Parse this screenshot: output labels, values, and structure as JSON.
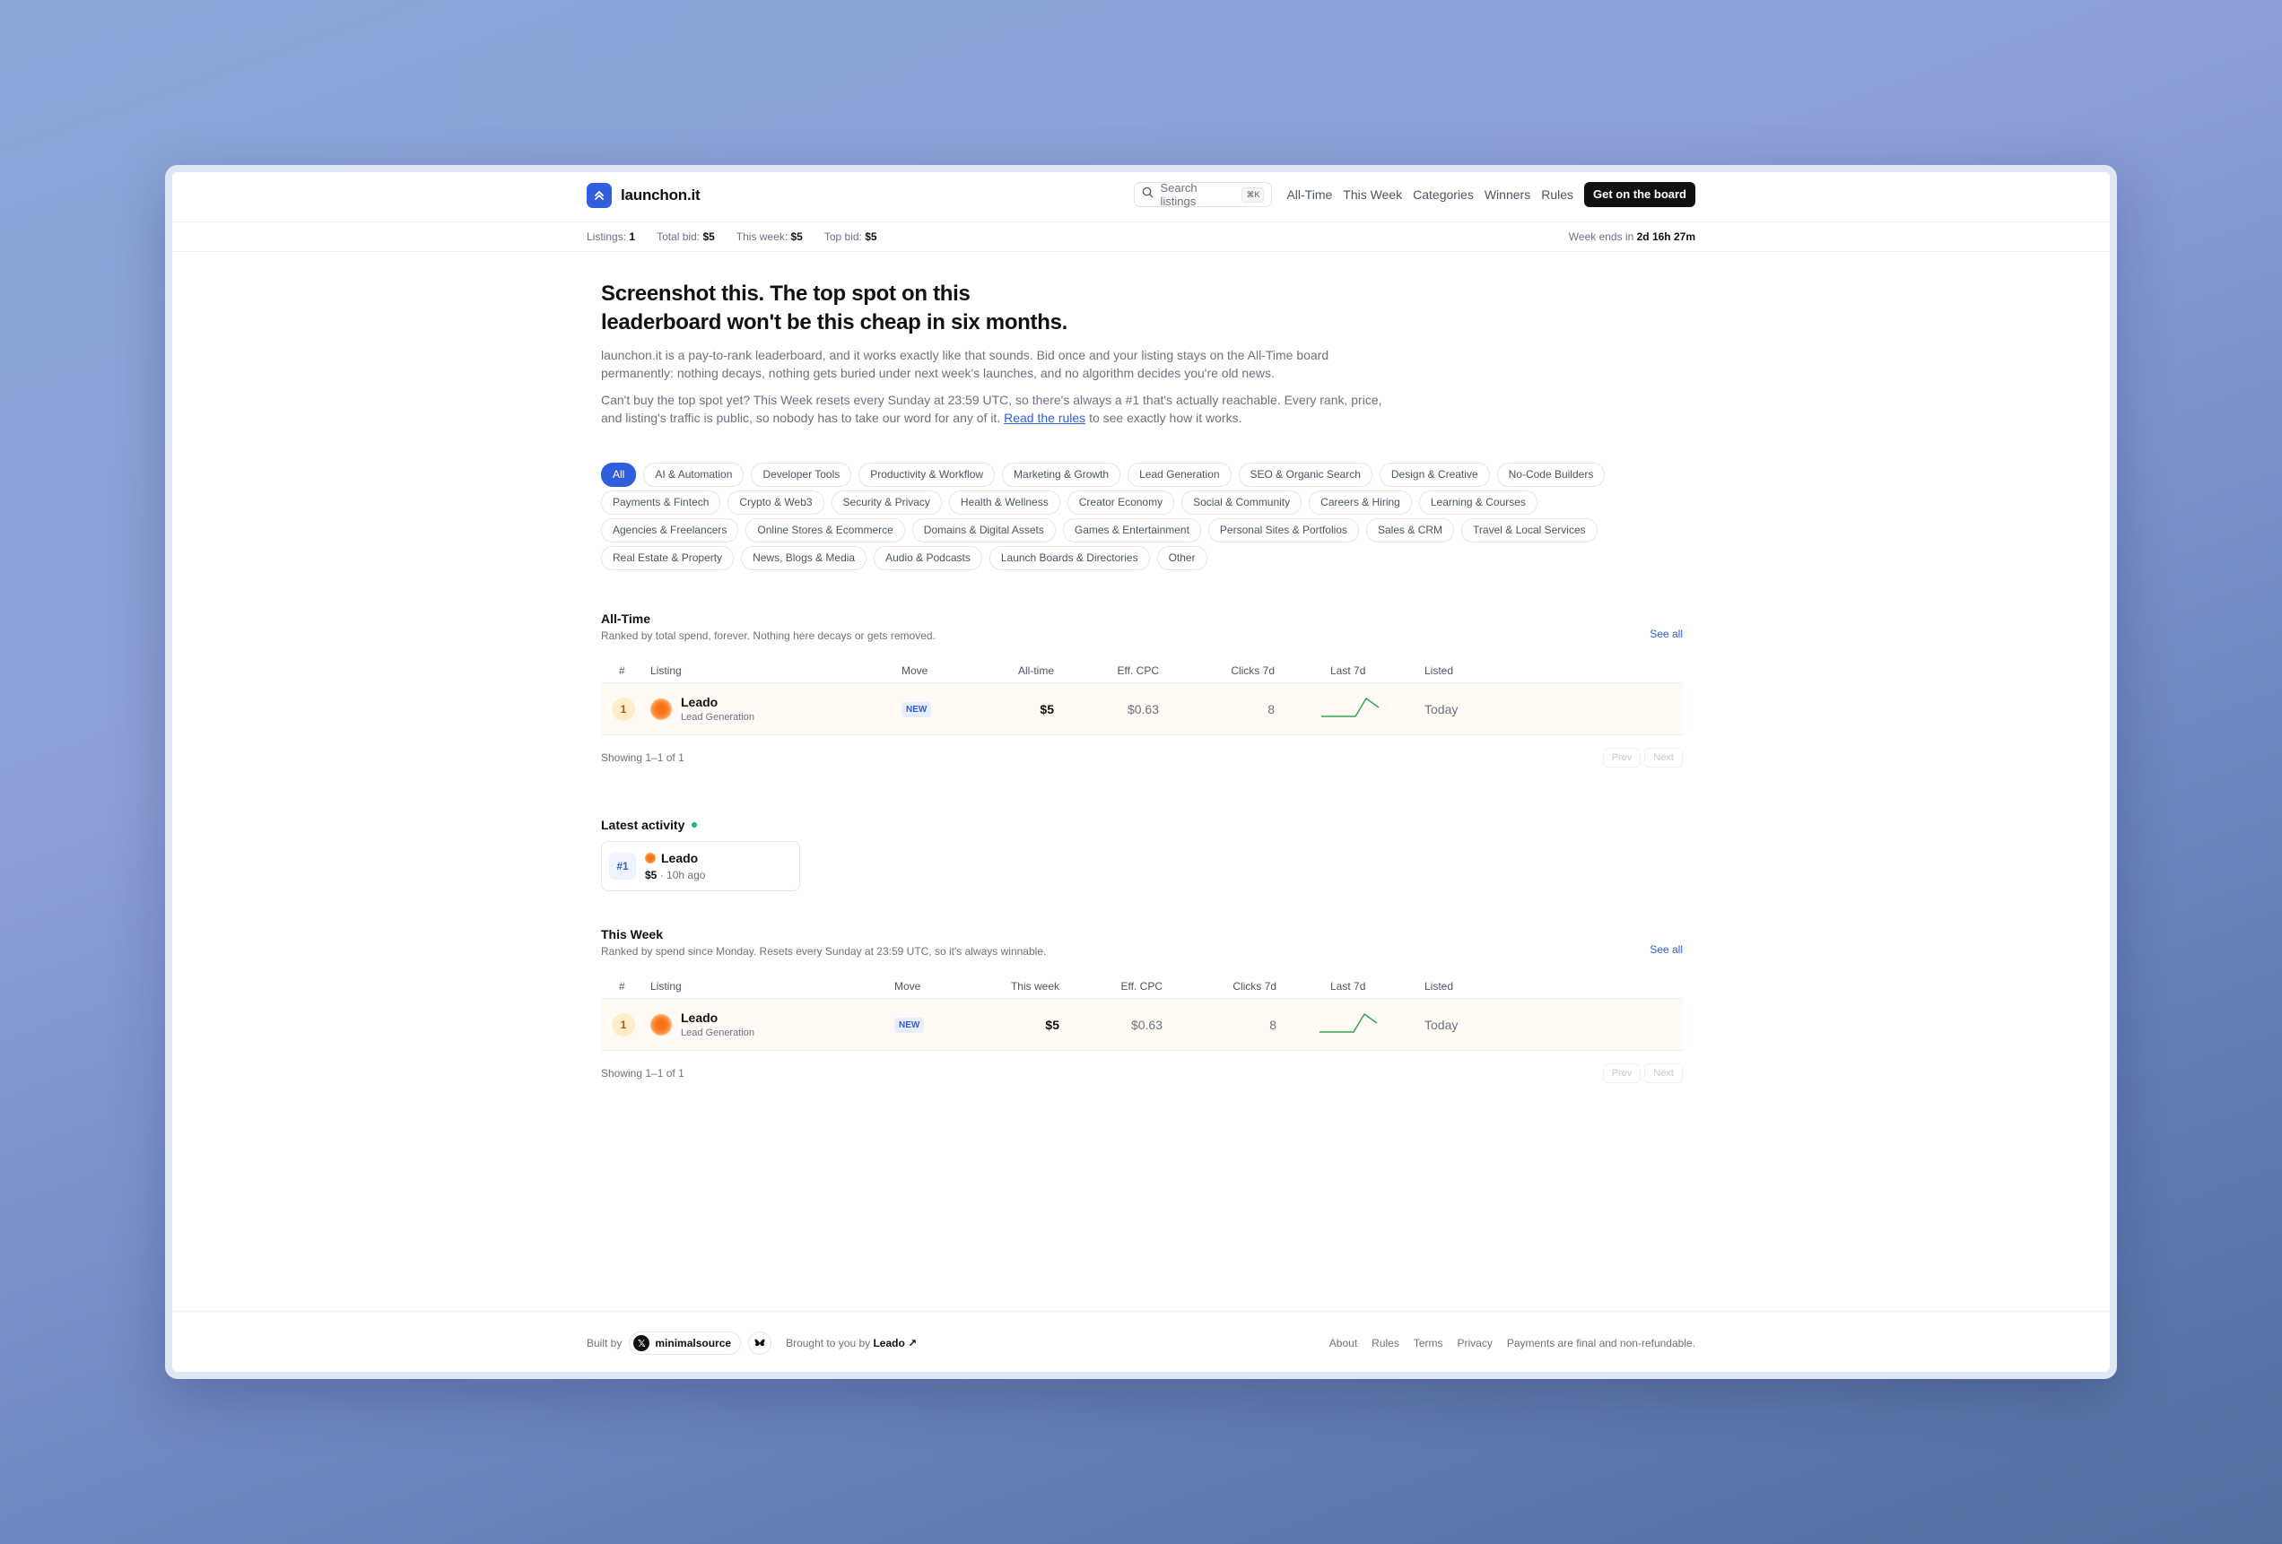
{
  "header": {
    "brand": "launchon.it",
    "search_placeholder": "Search listings",
    "search_shortcut": "⌘K",
    "nav": [
      "All-Time",
      "This Week",
      "Categories",
      "Winners",
      "Rules"
    ],
    "cta": "Get on the board"
  },
  "stats": {
    "listings_label": "Listings:",
    "listings": "1",
    "total_label": "Total bid:",
    "total": "$5",
    "week_label": "This week:",
    "week": "$5",
    "top_label": "Top bid:",
    "top": "$5",
    "ends_label": "Week ends in",
    "ends": "2d 16h 27m"
  },
  "hero": {
    "title": "Screenshot this. The top spot on this leaderboard won't be this cheap in six months.",
    "p1": "launchon.it is a pay-to-rank leaderboard, and it works exactly like that sounds. Bid once and your listing stays on the All-Time board permanently: nothing decays, nothing gets buried under next week's launches, and no algorithm decides you're old news.",
    "p2_before": "Can't buy the top spot yet? This Week resets every Sunday at 23:59 UTC, so there's always a #1 that's actually reachable. Every rank, price, and listing's traffic is public, so nobody has to take our word for any of it.",
    "p2_link": "Read the rules",
    "p2_after": "to see exactly how it works."
  },
  "categories": [
    "All",
    "AI & Automation",
    "Developer Tools",
    "Productivity & Workflow",
    "Marketing & Growth",
    "Lead Generation",
    "SEO & Organic Search",
    "Design & Creative",
    "No-Code Builders",
    "Payments & Fintech",
    "Crypto & Web3",
    "Security & Privacy",
    "Health & Wellness",
    "Creator Economy",
    "Social & Community",
    "Careers & Hiring",
    "Learning & Courses",
    "Agencies & Freelancers",
    "Online Stores & Ecommerce",
    "Domains & Digital Assets",
    "Games & Entertainment",
    "Personal Sites & Portfolios",
    "Sales & CRM",
    "Travel & Local Services",
    "Real Estate & Property",
    "News, Blogs & Media",
    "Audio & Podcasts",
    "Launch Boards & Directories",
    "Other"
  ],
  "alltime": {
    "title": "All-Time",
    "subtitle": "Ranked by total spend, forever. Nothing here decays or gets removed.",
    "see_all": "See all",
    "columns": [
      "#",
      "Listing",
      "Move",
      "All-time",
      "Eff. CPC",
      "Clicks 7d",
      "Last 7d",
      "Listed"
    ],
    "row": {
      "rank": "1",
      "name": "Leado",
      "category": "Lead Generation",
      "move": "NEW",
      "bid": "$5",
      "cpc": "$0.63",
      "clicks": "8",
      "listed": "Today"
    },
    "showing": "Showing 1–1 of 1",
    "prev": "Prev",
    "next": "Next"
  },
  "activity": {
    "title": "Latest activity",
    "rank": "#1",
    "name": "Leado",
    "amount": "$5",
    "sep": "·",
    "ago": "10h ago"
  },
  "thisweek": {
    "title": "This Week",
    "subtitle": "Ranked by spend since Monday. Resets every Sunday at 23:59 UTC, so it's always winnable.",
    "see_all": "See all",
    "columns": [
      "#",
      "Listing",
      "Move",
      "This week",
      "Eff. CPC",
      "Clicks 7d",
      "Last 7d",
      "Listed"
    ],
    "row": {
      "rank": "1",
      "name": "Leado",
      "category": "Lead Generation",
      "move": "NEW",
      "bid": "$5",
      "cpc": "$0.63",
      "clicks": "8",
      "listed": "Today"
    },
    "showing": "Showing 1–1 of 1",
    "prev": "Prev",
    "next": "Next"
  },
  "footer": {
    "built_by": "Built by",
    "author": "minimalsource",
    "brought": "Brought to you by",
    "sponsor": "Leado ↗",
    "links": [
      "About",
      "Rules",
      "Terms",
      "Privacy"
    ],
    "note": "Payments are final and non-refundable."
  },
  "colors": {
    "accent": "#2f5fdc",
    "positive": "#10b981",
    "sparkline": "#34a853"
  }
}
